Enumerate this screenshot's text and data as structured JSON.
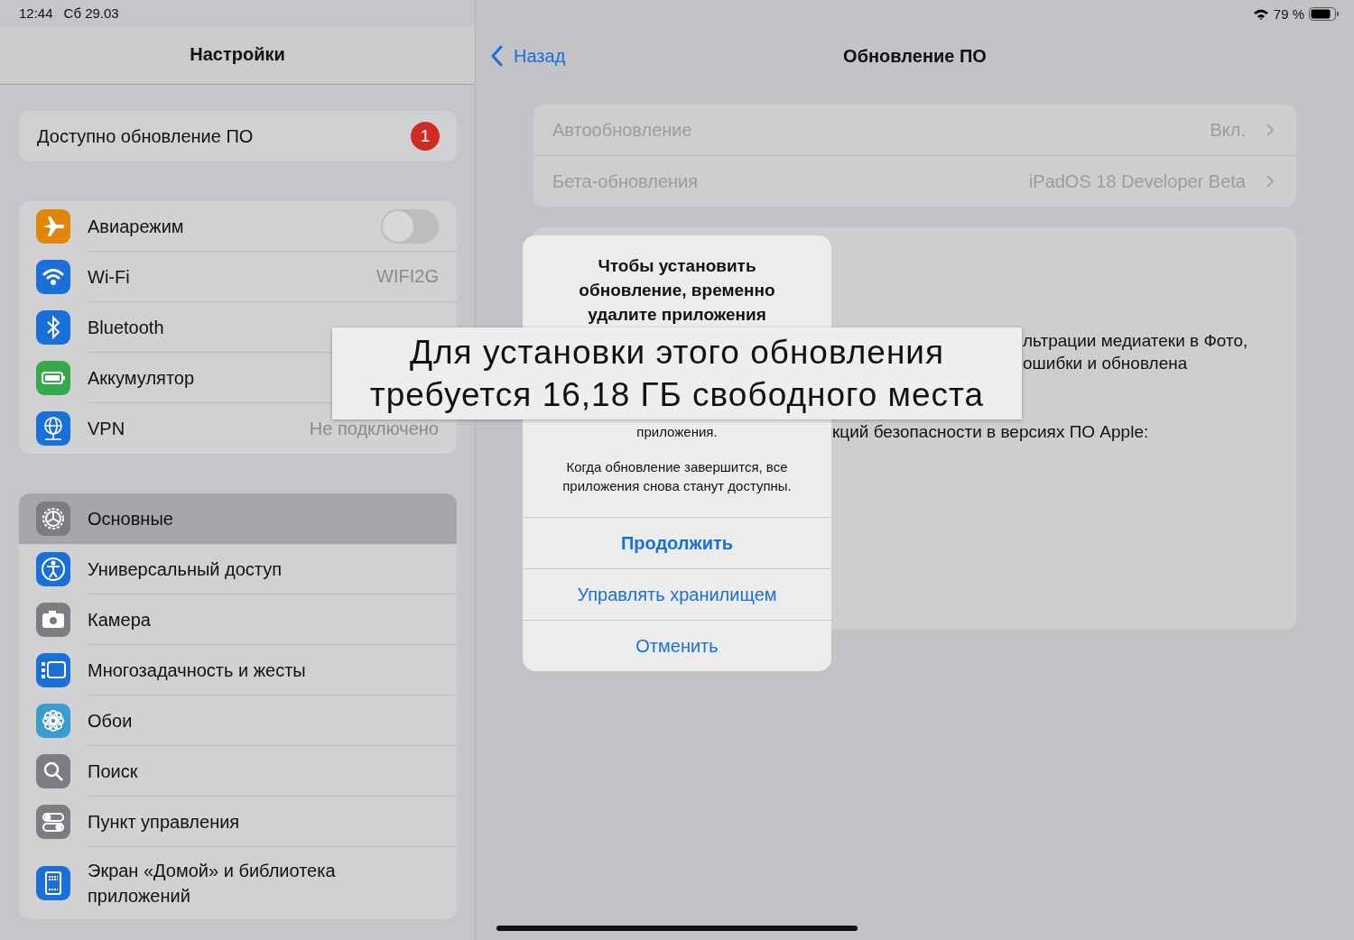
{
  "status_bar": {
    "time": "12:44",
    "date": "Сб 29.03",
    "battery": "79 %"
  },
  "sidebar": {
    "title": "Настройки",
    "update_banner": {
      "label": "Доступно обновление ПО",
      "badge": "1"
    },
    "groups": [
      {
        "items": [
          {
            "label": "Авиарежим",
            "kind": "toggle",
            "on": false,
            "color": "#e0860b",
            "selected": false
          },
          {
            "label": "Wi-Fi",
            "kind": "value",
            "value": "WIFI2G",
            "color": "#1a6fd9",
            "selected": false
          },
          {
            "label": "Bluetooth",
            "kind": "plain",
            "color": "#1a6fd9",
            "selected": false
          },
          {
            "label": "Аккумулятор",
            "kind": "plain",
            "color": "#36a94a",
            "selected": false
          },
          {
            "label": "VPN",
            "kind": "value",
            "value": "Не подключено",
            "color": "#1a6fd9",
            "selected": false
          }
        ]
      },
      {
        "items": [
          {
            "label": "Основные",
            "kind": "plain",
            "color": "#7d7d81",
            "selected": true
          },
          {
            "label": "Универсальный доступ",
            "kind": "plain",
            "color": "#1a6fd9",
            "selected": false
          },
          {
            "label": "Камера",
            "kind": "plain",
            "color": "#7d7d81",
            "selected": false
          },
          {
            "label": "Многозадачность и жесты",
            "kind": "plain",
            "color": "#1a6fd9",
            "selected": false
          },
          {
            "label": "Обои",
            "kind": "plain",
            "color": "#3a9ccf",
            "selected": false
          },
          {
            "label": "Поиск",
            "kind": "plain",
            "color": "#7d7d81",
            "selected": false
          },
          {
            "label": "Пункт управления",
            "kind": "plain",
            "color": "#7d7d81",
            "selected": false
          },
          {
            "label": "Экран «Домой» и библиотека приложений",
            "kind": "plain",
            "color": "#1a6fd9",
            "selected": false
          }
        ]
      }
    ]
  },
  "detail": {
    "back": "Назад",
    "title": "Обновление ПО",
    "settings": [
      {
        "label": "Автообновление",
        "value": "Вкл."
      },
      {
        "label": "Бета-обновления",
        "value": "iPadOS 18 Developer Beta"
      }
    ],
    "paragraphs": [
      {
        "lines": [
          "льтрации медиатеки в Фото,",
          "ошибки и обновлена"
        ]
      },
      {
        "lines": [
          "кций безопасности в версиях ПО Apple:"
        ]
      }
    ]
  },
  "alert": {
    "title": "Чтобы установить обновление, временно удалите приложения",
    "message_tail": "приложения.",
    "note": "Когда обновление завершится, все приложения снова станут доступны.",
    "actions": [
      {
        "label": "Продолжить",
        "bold": true
      },
      {
        "label": "Управлять хранилищем",
        "bold": false
      },
      {
        "label": "Отменить",
        "bold": false
      }
    ]
  },
  "callout": {
    "lines": [
      "Для установки этого обновления",
      "требуется 16,18 ГБ свободного места"
    ]
  }
}
